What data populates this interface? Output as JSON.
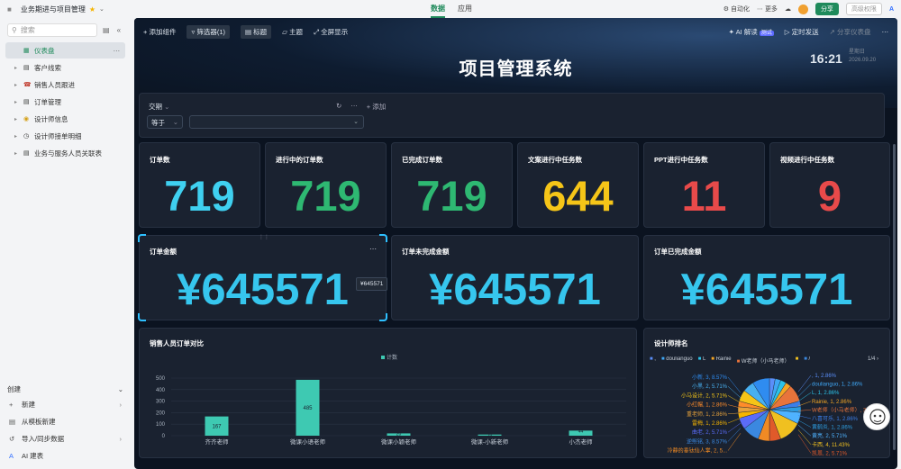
{
  "topbar": {
    "title": "业务期进与项目管理",
    "tabs": [
      "数据",
      "应用"
    ],
    "automation": "自动化",
    "more": "更多",
    "share": "分享",
    "permission": "高级权限"
  },
  "sidebar": {
    "search_placeholder": "搜索",
    "items": [
      {
        "label": "仪表盘",
        "icon": "dashboard-icon",
        "active": true
      },
      {
        "label": "客户线索",
        "icon": "table-icon"
      },
      {
        "label": "销售人员跟进",
        "icon": "phone-icon"
      },
      {
        "label": "订单管理",
        "icon": "order-icon"
      },
      {
        "label": "设计师信息",
        "icon": "designer-icon"
      },
      {
        "label": "设计师接单明细",
        "icon": "clock-icon"
      },
      {
        "label": "业务与服务人员关联表",
        "icon": "table-icon"
      }
    ],
    "create": {
      "title": "创建",
      "items": [
        "新建",
        "从模板新建",
        "导入/同步数据",
        "AI 建表"
      ]
    }
  },
  "dashboard": {
    "toolbar": {
      "add": "添加组件",
      "filter": "筛选器(1)",
      "titlebtn": "标题",
      "theme": "主题",
      "fullscreen": "全屏显示",
      "ai": "AI 解读",
      "ai_tag": "测试",
      "schedule": "定时发送",
      "share": "分享仪表盘"
    },
    "title": "项目管理系统",
    "time": "16:21",
    "weekday": "星期日",
    "date": "2026.09.20",
    "filter": {
      "field": "交期",
      "op": "等于",
      "add": "添加"
    },
    "kpis": [
      {
        "label": "订单数",
        "value": "719",
        "color": "#3fd0f0"
      },
      {
        "label": "进行中的订单数",
        "value": "719",
        "color": "#2eb872"
      },
      {
        "label": "已完成订单数",
        "value": "719",
        "color": "#2eb872"
      },
      {
        "label": "文案进行中任务数",
        "value": "644",
        "color": "#f5c518"
      },
      {
        "label": "PPT进行中任务数",
        "value": "11",
        "color": "#e84a4a"
      },
      {
        "label": "视频进行中任务数",
        "value": "9",
        "color": "#e84a4a"
      }
    ],
    "amounts": [
      {
        "label": "订单金额",
        "value": "¥645571"
      },
      {
        "label": "订单未完成金额",
        "value": "¥645571"
      },
      {
        "label": "订单已完成金额",
        "value": "¥645571"
      }
    ],
    "tooltip": "¥645571",
    "bar_title": "销售人员订单对比",
    "pie_title": "设计师排名",
    "pie_legend": [
      ",",
      "doulianguo",
      "L",
      "Rainie",
      "W老师（小马老师）",
      "",
      "/"
    ],
    "pie_page": "1/4",
    "pie_labels_left": [
      "小新, 3, 8.57%",
      "小黑, 2, 5.71%",
      "小马设计, 2, 5.71%",
      "小红帽, 1, 2.86%",
      "重老师, 1, 2.86%",
      "雷梅, 1, 2.86%",
      "曲老, 2, 5.71%",
      "逆熙铭, 3, 8.57%",
      "冷静的垂钛仙人掌, 2, 5..."
    ],
    "pie_labels_right": [
      ", 1, 2.86%",
      "doulianguo, 1, 2.86%",
      "L, 1, 2.86%",
      "Rainie, 1, 2.86%",
      "W老师（小马老师）, 3...",
      "八喜可乐, 1, 2.86%",
      "黄鹤炎, 1, 2.86%",
      "黄亮, 2, 5.71%",
      "卡西, 4, 11.43%",
      "凯恩, 2, 5.71%"
    ]
  },
  "chart_data": [
    {
      "type": "bar",
      "title": "销售人员订单对比",
      "categories": [
        "齐齐老师",
        "微课小语老师",
        "微课小颖老师",
        "微课-小新老师",
        "小杰老师"
      ],
      "series": [
        {
          "name": "计数",
          "values": [
            167,
            485,
            20,
            10,
            44
          ]
        }
      ],
      "ylim": [
        0,
        500
      ],
      "yticks": [
        0,
        100,
        200,
        300,
        400,
        500
      ],
      "grid": true,
      "legend": "top"
    },
    {
      "type": "pie",
      "title": "设计师排名",
      "slices": [
        {
          "label": "",
          "value": 1,
          "percent": 2.86,
          "color": "#5b8ff9"
        },
        {
          "label": "doulianguo",
          "value": 1,
          "percent": 2.86,
          "color": "#3fa7f5"
        },
        {
          "label": "L",
          "value": 1,
          "percent": 2.86,
          "color": "#2cc3e8"
        },
        {
          "label": "Rainie",
          "value": 1,
          "percent": 2.86,
          "color": "#f5a623"
        },
        {
          "label": "W老师（小马老师）",
          "value": 3,
          "percent": 8.57,
          "color": "#e8743b"
        },
        {
          "label": "八喜可乐",
          "value": 1,
          "percent": 2.86,
          "color": "#3c7ee8"
        },
        {
          "label": "黄鹤炎",
          "value": 1,
          "percent": 2.86,
          "color": "#2d9de0"
        },
        {
          "label": "黄亮",
          "value": 2,
          "percent": 5.71,
          "color": "#4fb3ff"
        },
        {
          "label": "卡西",
          "value": 4,
          "percent": 11.43,
          "color": "#f0c020"
        },
        {
          "label": "凯恩",
          "value": 2,
          "percent": 5.71,
          "color": "#e05a2a"
        },
        {
          "label": "冷静的垂钛仙人掌",
          "value": 2,
          "percent": 5.71,
          "color": "#f08a24"
        },
        {
          "label": "逆熙铭",
          "value": 3,
          "percent": 8.57,
          "color": "#3b88e0"
        },
        {
          "label": "曲老",
          "value": 2,
          "percent": 5.71,
          "color": "#5b6cf9"
        },
        {
          "label": "雷梅",
          "value": 1,
          "percent": 2.86,
          "color": "#f7b500"
        },
        {
          "label": "重老师",
          "value": 1,
          "percent": 2.86,
          "color": "#e8a33b"
        },
        {
          "label": "小红帽",
          "value": 1,
          "percent": 2.86,
          "color": "#ff8c2a"
        },
        {
          "label": "小马设计",
          "value": 2,
          "percent": 5.71,
          "color": "#f5c518"
        },
        {
          "label": "小黑",
          "value": 2,
          "percent": 5.71,
          "color": "#48b0f0"
        },
        {
          "label": "小新",
          "value": 3,
          "percent": 8.57,
          "color": "#2f8cf0"
        }
      ]
    }
  ]
}
